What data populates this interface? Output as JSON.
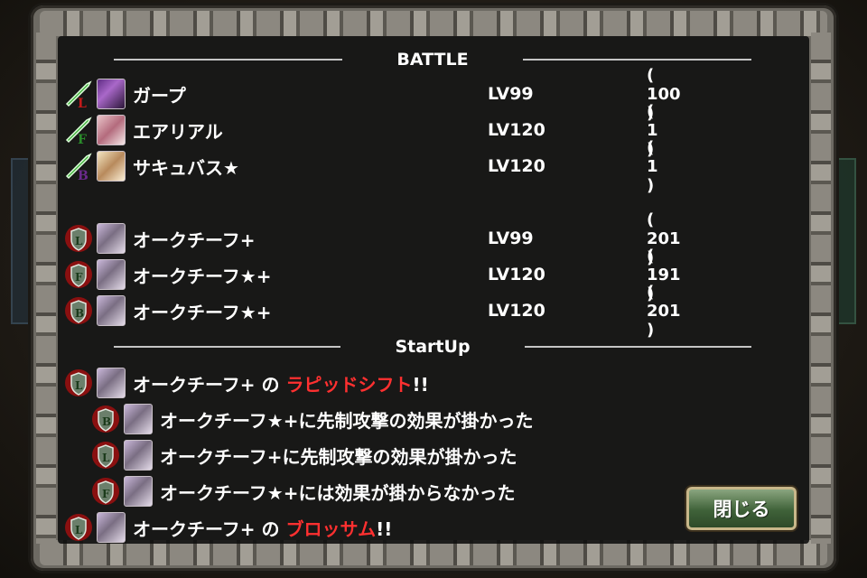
{
  "battle": {
    "title": "BATTLE",
    "allies": [
      {
        "cls": "L",
        "name": "ガープ",
        "level": "LV99",
        "count": "( 100 )"
      },
      {
        "cls": "F",
        "name": "エアリアル",
        "level": "LV120",
        "count": "( 1 )"
      },
      {
        "cls": "B",
        "name": "サキュバス★",
        "level": "LV120",
        "count": "( 1 )"
      }
    ],
    "enemies": [
      {
        "cls": "L",
        "name": "オークチーフ+",
        "level": "LV99",
        "count": "( 201 )"
      },
      {
        "cls": "F",
        "name": "オークチーフ★+",
        "level": "LV120",
        "count": "( 191 )"
      },
      {
        "cls": "B",
        "name": "オークチーフ★+",
        "level": "LV120",
        "count": "( 201 )"
      }
    ]
  },
  "startup": {
    "title": "StartUp",
    "log": [
      {
        "cls": "L",
        "actor": "オークチーフ+",
        "particle": " の ",
        "skill": "ラピッドシフト",
        "suffix": "!!"
      },
      {
        "cls": "B",
        "text": "オークチーフ★+に先制攻撃の効果が掛かった"
      },
      {
        "cls": "L",
        "text": "オークチーフ+に先制攻撃の効果が掛かった"
      },
      {
        "cls": "F",
        "text": "オークチーフ★+には効果が掛からなかった"
      },
      {
        "cls": "L",
        "actor": "オークチーフ+",
        "particle": " の ",
        "skill": "ブロッサム",
        "suffix": "!!"
      }
    ]
  },
  "close_button": {
    "label": "閉じる"
  },
  "colors": {
    "skill": "#ff3030",
    "ally_icon": "#3fae3a",
    "enemy_icon": "#b01818"
  }
}
